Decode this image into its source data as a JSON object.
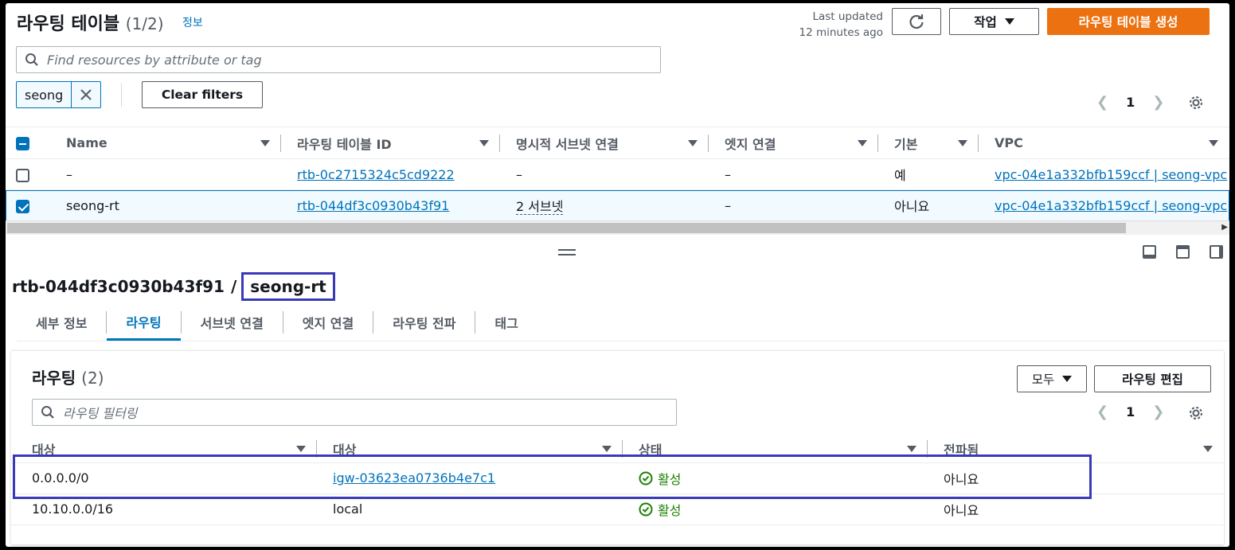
{
  "header": {
    "title": "라우팅 테이블",
    "count": "(1/2)",
    "info": "정보",
    "last_updated_line1": "Last updated",
    "last_updated_line2": "12 minutes ago",
    "actions_label": "작업",
    "create_label": "라우팅 테이블 생성"
  },
  "search": {
    "placeholder": "Find resources by attribute or tag"
  },
  "filters": {
    "chip": "seong",
    "clear_label": "Clear filters"
  },
  "pager": {
    "page": "1"
  },
  "table": {
    "columns": [
      "Name",
      "라우팅 테이블 ID",
      "명시적 서브넷 연결",
      "엣지 연결",
      "기본",
      "VPC"
    ],
    "rows": [
      {
        "name": "–",
        "id": "rtb-0c2715324c5cd9222",
        "subnets": "–",
        "edge": "–",
        "main": "예",
        "vpc": "vpc-04e1a332bfb159ccf | seong-vpc",
        "selected": false
      },
      {
        "name": "seong-rt",
        "id": "rtb-044df3c0930b43f91",
        "subnets": "2 서브넷",
        "edge": "–",
        "main": "아니요",
        "vpc": "vpc-04e1a332bfb159ccf | seong-vpc",
        "selected": true
      }
    ]
  },
  "detail": {
    "id": "rtb-044df3c0930b43f91",
    "slash": "/",
    "name": "seong-rt",
    "tabs": [
      "세부 정보",
      "라우팅",
      "서브넷 연결",
      "엣지 연결",
      "라우팅 전파",
      "태그"
    ],
    "active_tab": "라우팅"
  },
  "routes": {
    "title": "라우팅",
    "count": "(2)",
    "filter_select": "모두",
    "edit_label": "라우팅 편집",
    "filter_placeholder": "라우팅 필터링",
    "page": "1",
    "columns": [
      "대상",
      "대상",
      "상태",
      "전파됨"
    ],
    "rows": [
      {
        "destination": "0.0.0.0/0",
        "target": "igw-03623ea0736b4e7c1",
        "status": "활성",
        "propagated": "아니요"
      },
      {
        "destination": "10.10.0.0/16",
        "target": "local",
        "status": "활성",
        "propagated": "아니요"
      }
    ]
  },
  "colors": {
    "accent": "#0073bb",
    "primary_button": "#ec7211",
    "success": "#1d8102",
    "highlight_box": "#3a3ab8"
  }
}
